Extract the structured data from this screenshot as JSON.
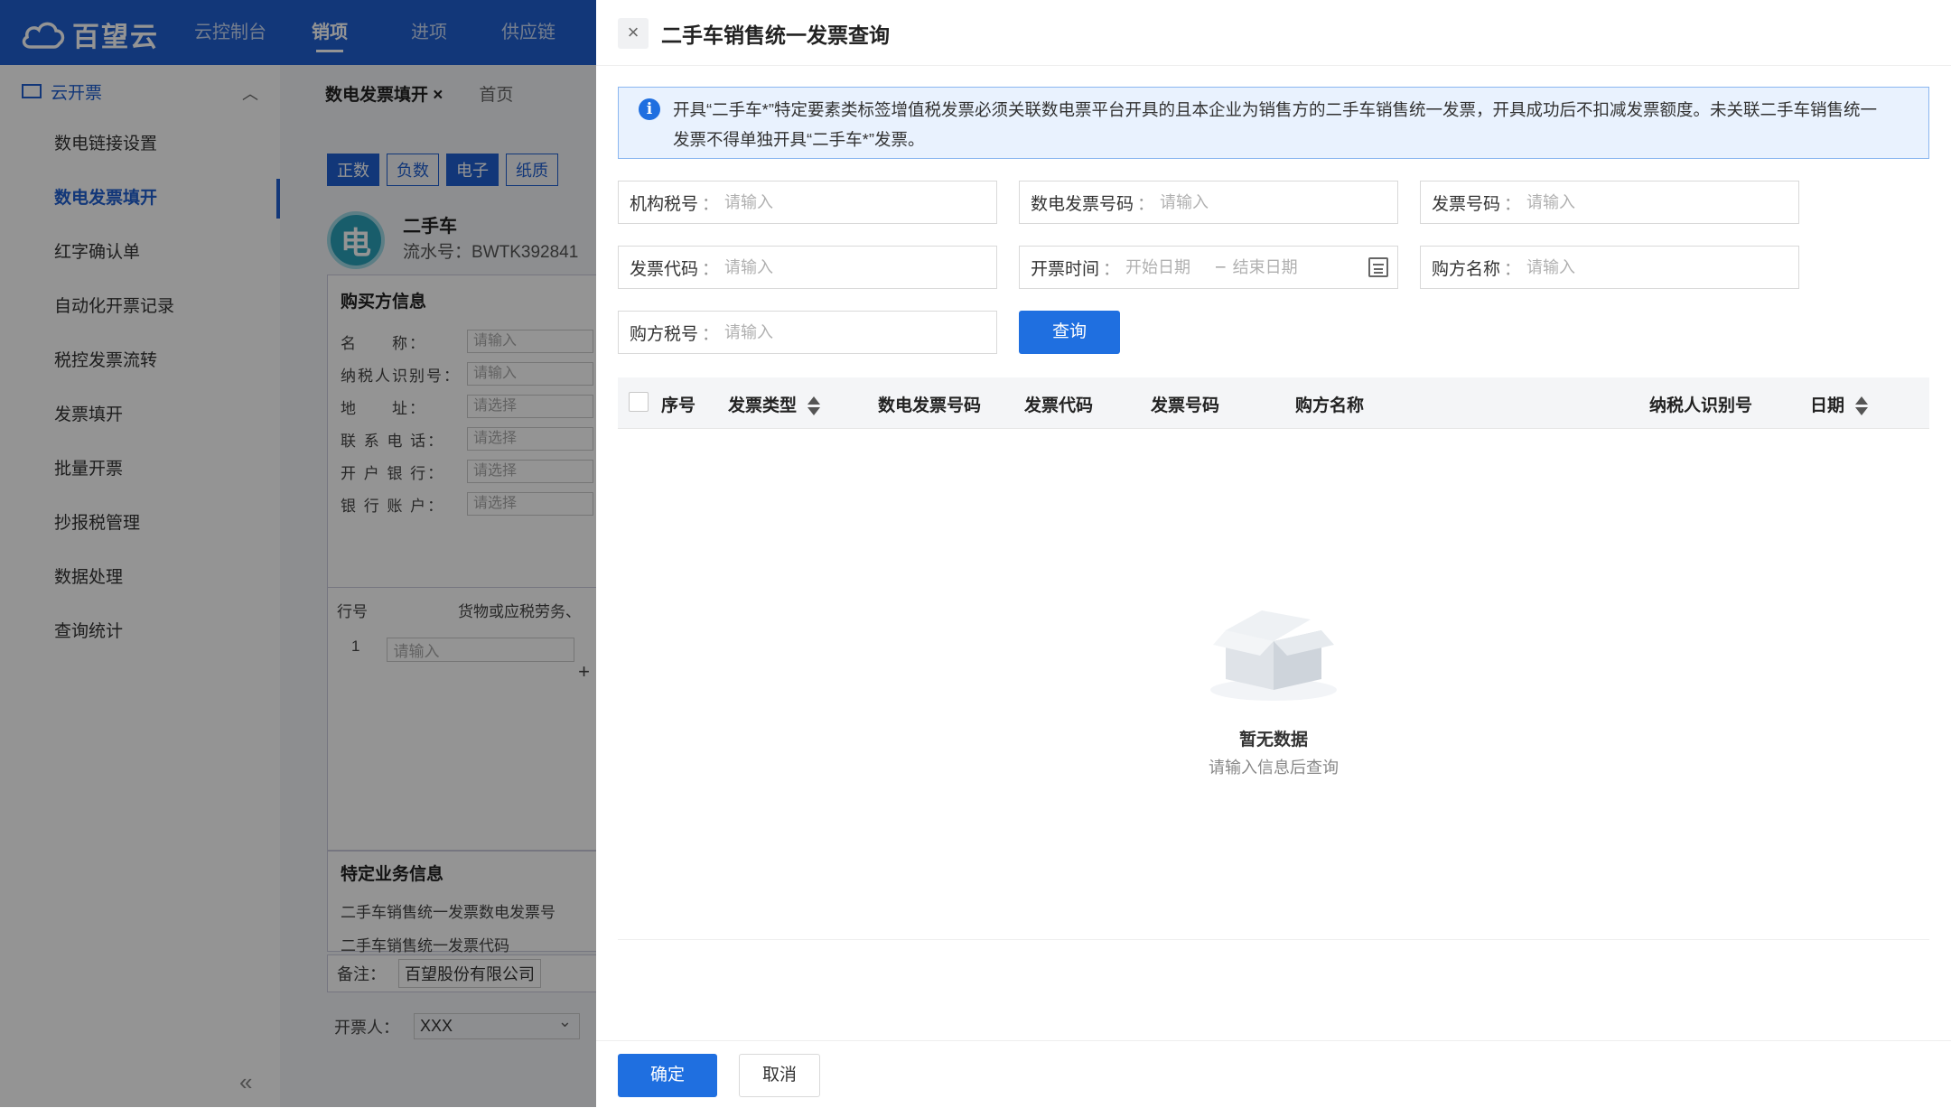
{
  "app": {
    "brand": "百望云",
    "nav": [
      "云控制台",
      "销项",
      "进项",
      "供应链"
    ],
    "nav_active_index": 1,
    "sidebar": {
      "group": "云开票",
      "items": [
        "数电链接设置",
        "数电发票填开",
        "红字确认单",
        "自动化开票记录",
        "税控发票流转",
        "发票填开",
        "批量开票",
        "抄报税管理",
        "数据处理",
        "查询统计"
      ],
      "active_index": 1
    },
    "tabs": [
      "数电发票填开",
      "首页"
    ],
    "segments": [
      "正数",
      "负数",
      "电子",
      "纸质"
    ],
    "card": {
      "badge": "电",
      "title": "二手车",
      "serial_label": "流水号：",
      "serial_value": "BWTK392841"
    },
    "buyer": {
      "title": "购买方信息",
      "rows": [
        {
          "label": "名　　称：",
          "placeholder": "请输入"
        },
        {
          "label": "纳税人识别号：",
          "placeholder": "请输入"
        },
        {
          "label": "地　　址：",
          "placeholder": "请选择"
        },
        {
          "label": "联 系 电 话：",
          "placeholder": "请选择"
        },
        {
          "label": "开 户 银 行：",
          "placeholder": "请选择"
        },
        {
          "label": "银 行 账 户：",
          "placeholder": "请选择"
        }
      ]
    },
    "goods": {
      "col_line": "行号",
      "col_name": "货物或应税劳务、",
      "row_no": "1",
      "row_placeholder": "请输入"
    },
    "special": {
      "title": "特定业务信息",
      "line1": "二手车销售统一发票数电发票号",
      "line2": "二手车销售统一发票代码"
    },
    "remark": {
      "label": "备注：",
      "value": "百望股份有限公司"
    },
    "issuer": {
      "label": "开票人：",
      "value": "XXX"
    }
  },
  "dialog": {
    "title": "二手车销售统一发票查询",
    "notice": "开具“二手车*”特定要素类标签增值税发票必须关联数电票平台开具的且本企业为销售方的二手车销售统一发票，开具成功后不扣减发票额度。未关联二手车销售统一发票不得单独开具“二手车*”发票。",
    "filters": {
      "org_tax_no": {
        "label": "机构税号",
        "placeholder": "请输入"
      },
      "digital_no": {
        "label": "数电发票号码",
        "placeholder": "请输入"
      },
      "invoice_no": {
        "label": "发票号码",
        "placeholder": "请输入"
      },
      "invoice_code": {
        "label": "发票代码",
        "placeholder": "请输入"
      },
      "issue_time": {
        "label": "开票时间",
        "start_placeholder": "开始日期",
        "end_placeholder": "结束日期",
        "range_sep": "–"
      },
      "buyer_name": {
        "label": "购方名称",
        "placeholder": "请输入"
      },
      "buyer_tax_no": {
        "label": "购方税号",
        "placeholder": "请输入"
      },
      "colon": "："
    },
    "query_button": "查询",
    "table": {
      "columns": [
        "序号",
        "发票类型",
        "数电发票号码",
        "发票代码",
        "发票号码",
        "购方名称",
        "纳税人识别号",
        "日期"
      ]
    },
    "empty": {
      "title": "暂无数据",
      "subtitle": "请输入信息后查询"
    },
    "footer": {
      "confirm": "确定",
      "cancel": "取消"
    }
  },
  "colors": {
    "primary": "#1f6fe0",
    "nav_bg": "#1f5fd1",
    "notice_bg": "#e9f2fe",
    "notice_border": "#8bb7f0",
    "overlay": "rgba(0,0,0,0.42)"
  }
}
